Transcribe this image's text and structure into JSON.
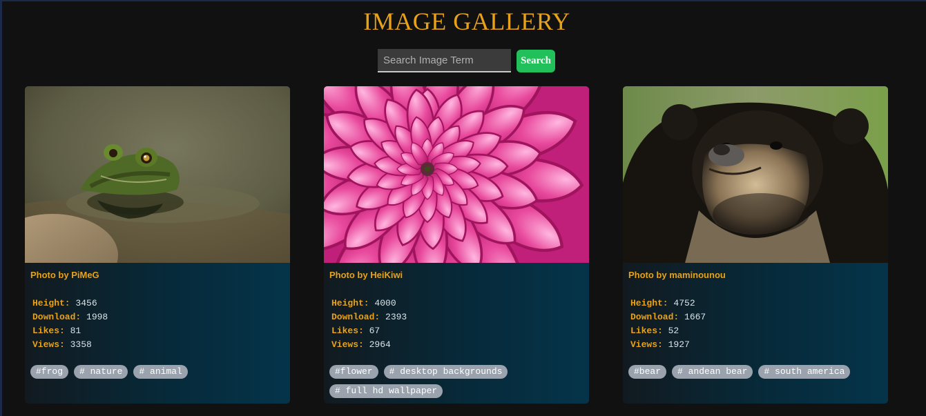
{
  "header": {
    "title": "IMAGE GALLERY"
  },
  "search": {
    "placeholder": "Search Image Term",
    "value": "",
    "button_label": "Search"
  },
  "stat_labels": {
    "height": "Height:",
    "downloads": "Download:",
    "likes": "Likes:",
    "views": "Views:"
  },
  "cards": [
    {
      "photographer": "Photo by PiMeG",
      "height": "3456",
      "downloads": "1998",
      "likes": "81",
      "views": "3358",
      "tags": [
        "#frog",
        "# nature",
        "# animal"
      ],
      "image_subject": "frog"
    },
    {
      "photographer": "Photo by HeiKiwi",
      "height": "4000",
      "downloads": "2393",
      "likes": "67",
      "views": "2964",
      "tags": [
        "#flower",
        "# desktop backgrounds",
        "# full hd wallpaper"
      ],
      "image_subject": "pink dahlia flower"
    },
    {
      "photographer": "Photo by maminounou",
      "height": "4752",
      "downloads": "1667",
      "likes": "52",
      "views": "1927",
      "tags": [
        "#bear",
        "# andean bear",
        "# south america"
      ],
      "image_subject": "andean bear"
    }
  ],
  "colors": {
    "background": "#111111",
    "accent": "#e8a21a",
    "search_button": "#22c05a",
    "tag_background": "#9aa3ad",
    "card_gradient_end": "#05344a"
  }
}
